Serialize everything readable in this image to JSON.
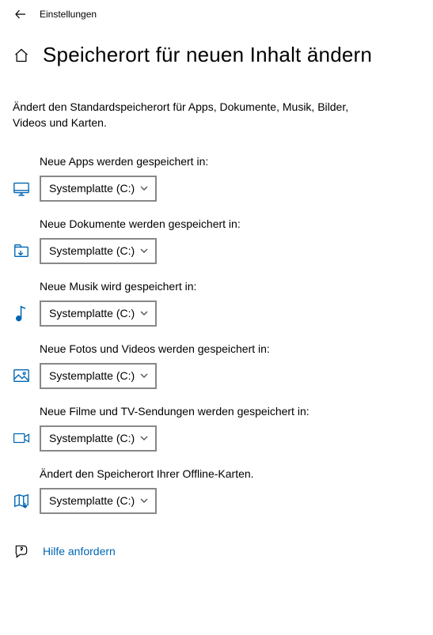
{
  "topbar": {
    "label": "Einstellungen"
  },
  "header": {
    "title": "Speicherort für neuen Inhalt ändern"
  },
  "subtitle": "Ändert den Standardspeicherort für Apps, Dokumente, Musik, Bilder, Videos und Karten.",
  "rows": [
    {
      "icon": "apps",
      "label": "Neue Apps werden gespeichert in:",
      "value": "Systemplatte (C:)"
    },
    {
      "icon": "doc",
      "label": "Neue Dokumente werden gespeichert in:",
      "value": "Systemplatte (C:)"
    },
    {
      "icon": "music",
      "label": "Neue Musik wird gespeichert in:",
      "value": "Systemplatte (C:)"
    },
    {
      "icon": "photo",
      "label": "Neue Fotos und Videos werden gespeichert in:",
      "value": "Systemplatte (C:)"
    },
    {
      "icon": "film",
      "label": "Neue Filme und TV-Sendungen werden gespeichert in:",
      "value": "Systemplatte (C:)"
    },
    {
      "icon": "map",
      "label": "Ändert den Speicherort Ihrer Offline-Karten.",
      "value": "Systemplatte (C:)"
    }
  ],
  "help": {
    "text": "Hilfe anfordern"
  }
}
